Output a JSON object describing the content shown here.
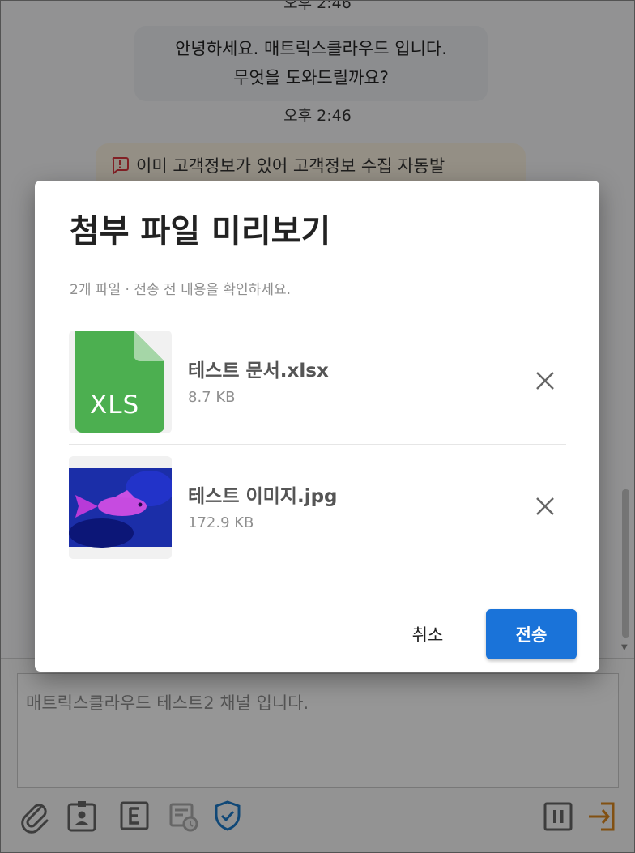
{
  "chat": {
    "top_time": "오후 2:46",
    "bubble_lines": [
      "안녕하세요. 매트릭스클라우드 입니다.",
      "무엇을 도와드릴까요?"
    ],
    "bubble_time": "오후 2:46",
    "warning_text": "이미 고객정보가 있어 고객정보 수집 자동발"
  },
  "composer": {
    "placeholder": "매트릭스클라우드 테스트2 채널 입니다.",
    "icons": [
      "paperclip-icon",
      "contact-card-icon",
      "e-icon",
      "history-icon",
      "shield-check-icon",
      "pause-icon",
      "exit-icon"
    ]
  },
  "dialog": {
    "title": "첨부 파일 미리보기",
    "subtitle": "2개 파일 · 전송 전 내용을 확인하세요.",
    "files": [
      {
        "name": "테스트 문서.xlsx",
        "size": "8.7 KB",
        "thumb_label": "XLS",
        "icon": "xlsx-file-icon"
      },
      {
        "name": "테스트 이미지.jpg",
        "size": "172.9 KB",
        "icon": "image-thumbnail"
      }
    ],
    "cancel_label": "취소",
    "send_label": "전송"
  },
  "colors": {
    "send_button": "#1a73d9",
    "xls_green": "#4caf50",
    "warning_red": "#d9363e",
    "shield_blue": "#1b78c7",
    "exit_orange": "#d9861f"
  }
}
